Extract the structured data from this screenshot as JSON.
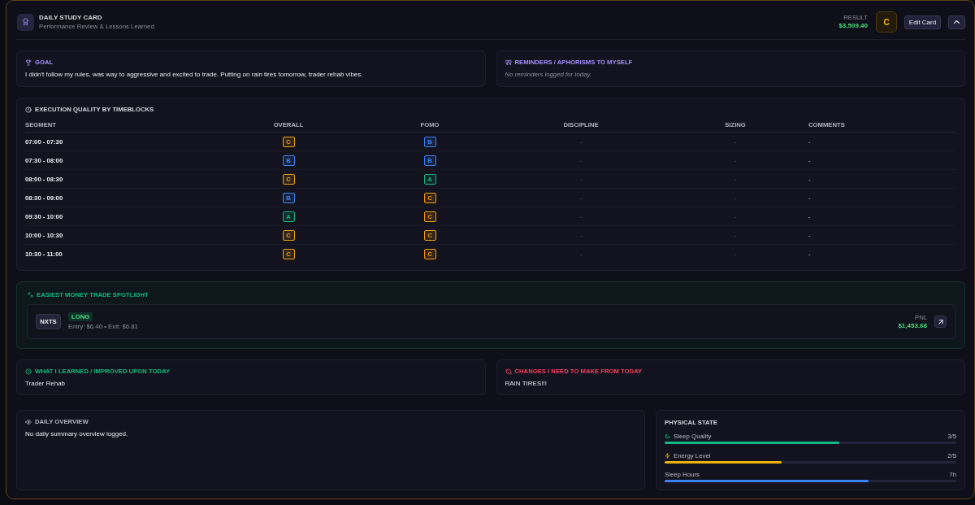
{
  "header": {
    "title": "DAILY STUDY CARD",
    "subtitle": "Performance Review & Lessons Learned",
    "result_label": "RESULT",
    "result_value": "$3,509.40",
    "grade": "C",
    "edit_button": "Edit Card"
  },
  "goal": {
    "title": "GOAL",
    "text": "I didn't follow my rules, was way to aggressive and excited to trade. Putting on rain tires tomorrow, trader rehab vibes."
  },
  "reminders": {
    "title": "REMINDERS / APHORISMS TO MYSELF",
    "empty_text": "No reminders logged for today."
  },
  "execution": {
    "title": "EXECUTION QUALITY BY TIMEBLOCKS",
    "columns": [
      "SEGMENT",
      "OVERALL",
      "FOMO",
      "DISCIPLINE",
      "SIZING",
      "COMMENTS"
    ],
    "rows": [
      {
        "segment": "07:00 - 07:30",
        "overall": {
          "grade": "C",
          "color": "#f59e0b"
        },
        "fomo": {
          "grade": "B",
          "color": "#3b82f6"
        },
        "discipline": "-",
        "sizing": "-",
        "comments": "-"
      },
      {
        "segment": "07:30 - 08:00",
        "overall": {
          "grade": "B",
          "color": "#3b82f6"
        },
        "fomo": {
          "grade": "B",
          "color": "#3b82f6"
        },
        "discipline": "-",
        "sizing": "-",
        "comments": "-"
      },
      {
        "segment": "08:00 - 08:30",
        "overall": {
          "grade": "C",
          "color": "#f59e0b"
        },
        "fomo": {
          "grade": "A",
          "color": "#10b981"
        },
        "discipline": "-",
        "sizing": "-",
        "comments": "-"
      },
      {
        "segment": "08:30 - 09:00",
        "overall": {
          "grade": "B",
          "color": "#3b82f6"
        },
        "fomo": {
          "grade": "C",
          "color": "#f59e0b"
        },
        "discipline": "-",
        "sizing": "-",
        "comments": "-"
      },
      {
        "segment": "09:30 - 10:00",
        "overall": {
          "grade": "A",
          "color": "#10b981"
        },
        "fomo": {
          "grade": "C",
          "color": "#f59e0b"
        },
        "discipline": "-",
        "sizing": "-",
        "comments": "-"
      },
      {
        "segment": "10:00 - 10:30",
        "overall": {
          "grade": "C",
          "color": "#f59e0b"
        },
        "fomo": {
          "grade": "C",
          "color": "#f59e0b"
        },
        "discipline": "-",
        "sizing": "-",
        "comments": "-"
      },
      {
        "segment": "10:30 - 11:00",
        "overall": {
          "grade": "C",
          "color": "#f59e0b"
        },
        "fomo": {
          "grade": "C",
          "color": "#f59e0b"
        },
        "discipline": "-",
        "sizing": "-",
        "comments": "-"
      }
    ]
  },
  "spotlight": {
    "title": "EASIEST MONEY TRADE SPOTLIGHT",
    "ticker": "NXTS",
    "side": "LONG",
    "details": "Entry: $6.40 • Exit: $6.81",
    "pnl_label": "PNL",
    "pnl": "$1,453.68"
  },
  "learned": {
    "title": "WHAT I LEARNED / IMPROVED UPON TODAY",
    "text": "Trader Rehab"
  },
  "changes": {
    "title": "CHANGES I NEED TO MAKE FROM TODAY",
    "text": "RAIN TIRES!!!"
  },
  "overview": {
    "title": "DAILY OVERVIEW",
    "text": "No daily summary overview logged."
  },
  "physical_state": {
    "title": "PHYSICAL STATE",
    "metrics": [
      {
        "kind": "sleep",
        "name": "Sleep Quality",
        "reading": "3/5",
        "level": 0.6,
        "color": "#10b981"
      },
      {
        "kind": "energy",
        "name": "Energy Level",
        "reading": "2/5",
        "level": 0.4,
        "color": "#eab308"
      },
      {
        "kind": "duration",
        "name": "Sleep Hours",
        "reading": "7h",
        "level": 0.7,
        "color": "#3b82f6"
      }
    ]
  }
}
